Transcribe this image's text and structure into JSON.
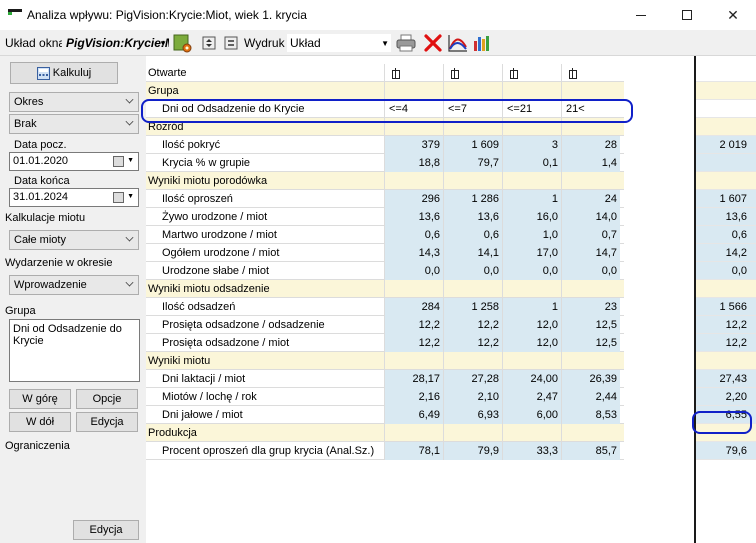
{
  "window": {
    "title": "Analiza wpływu: PigVision:Krycie:Miot, wiek 1. krycia",
    "min_glyph": "",
    "close_glyph": "✕"
  },
  "toolbar": {
    "layout_label": "Układ okna",
    "layout_value": "PigVision:Krycie:M",
    "print_label": "Wydruk",
    "print_value": "Układ",
    "icons": [
      "settings-gear-icon",
      "expand-icon",
      "collapse-icon",
      "printer-icon",
      "delete-icon",
      "chart-curve-icon",
      "bar-chart-icon"
    ]
  },
  "left": {
    "calculate_button": "Kalkuluj",
    "period_combo": "Okres",
    "none_combo": "Brak",
    "start_date_label": "Data pocz.",
    "start_date": "01.01.2020",
    "end_date_label": "Data końca",
    "end_date": "31.01.2024",
    "litter_calc_label": "Kalkulacje miotu",
    "litter_calc_value": "Całe mioty",
    "event_label": "Wydarzenie w okresie",
    "event_value": "Wprowadzenie",
    "group_label": "Grupa",
    "group_value": "Dni od Odsadzenie do Krycie",
    "up_button": "W górę",
    "options_button": "Opcje",
    "down_button": "W dół",
    "edit_button": "Edycja",
    "limits_label": "Ograniczenia",
    "limits_edit_button": "Edycja"
  },
  "grid": {
    "columns": [
      "<=4",
      "<=7",
      "<=21",
      "21<"
    ],
    "rows": [
      {
        "type": "hdr",
        "label": "Otwarte",
        "pins": true
      },
      {
        "type": "group",
        "label": "Grupa"
      },
      {
        "type": "hdr",
        "label": "Dni od Odsadzenie do Krycie",
        "indent": true,
        "values": [
          "<=4",
          "<=7",
          "<=21",
          "21<"
        ]
      },
      {
        "type": "group",
        "label": "Rozród"
      },
      {
        "type": "data",
        "label": "Ilość pokryć",
        "values": [
          "379",
          "1 609",
          "3",
          "28"
        ],
        "total": "2 019"
      },
      {
        "type": "data",
        "label": "Krycia % w grupie",
        "values": [
          "18,8",
          "79,7",
          "0,1",
          "1,4"
        ],
        "total": ""
      },
      {
        "type": "group",
        "label": "Wyniki miotu porodówka"
      },
      {
        "type": "data",
        "label": "Ilość oproszeń",
        "values": [
          "296",
          "1 286",
          "1",
          "24"
        ],
        "total": "1 607"
      },
      {
        "type": "data",
        "label": "Żywo urodzone / miot",
        "values": [
          "13,6",
          "13,6",
          "16,0",
          "14,0"
        ],
        "total": "13,6"
      },
      {
        "type": "data",
        "label": "Martwo urodzone / miot",
        "values": [
          "0,6",
          "0,6",
          "1,0",
          "0,7"
        ],
        "total": "0,6"
      },
      {
        "type": "data",
        "label": "Ogółem urodzone / miot",
        "values": [
          "14,3",
          "14,1",
          "17,0",
          "14,7"
        ],
        "total": "14,2"
      },
      {
        "type": "data",
        "label": "Urodzone słabe / miot",
        "values": [
          "0,0",
          "0,0",
          "0,0",
          "0,0"
        ],
        "total": "0,0"
      },
      {
        "type": "group",
        "label": "Wyniki miotu odsadzenie"
      },
      {
        "type": "data",
        "label": "Ilość odsadzeń",
        "values": [
          "284",
          "1 258",
          "1",
          "23"
        ],
        "total": "1 566"
      },
      {
        "type": "data",
        "label": "Prosięta odsadzone / odsadzenie",
        "values": [
          "12,2",
          "12,2",
          "12,0",
          "12,5"
        ],
        "total": "12,2"
      },
      {
        "type": "data",
        "label": "Prosięta odsadzone / miot",
        "values": [
          "12,2",
          "12,2",
          "12,0",
          "12,5"
        ],
        "total": "12,2"
      },
      {
        "type": "group",
        "label": "Wyniki miotu"
      },
      {
        "type": "data",
        "label": "Dni laktacji / miot",
        "values": [
          "28,17",
          "27,28",
          "24,00",
          "26,39"
        ],
        "total": "27,43"
      },
      {
        "type": "data",
        "label": "Miotów / lochę / rok",
        "values": [
          "2,16",
          "2,10",
          "2,47",
          "2,44"
        ],
        "total": "2,20"
      },
      {
        "type": "data",
        "label": "Dni jałowe / miot",
        "values": [
          "6,49",
          "6,93",
          "6,00",
          "8,53"
        ],
        "total": "6,55"
      },
      {
        "type": "group",
        "label": "Produkcja"
      },
      {
        "type": "data",
        "label": "Procent oproszeń dla grup krycia (Anal.Sz.)",
        "values": [
          "78,1",
          "79,9",
          "33,3",
          "85,7"
        ],
        "total": "79,6"
      }
    ]
  },
  "colors": {
    "group_bg": "#fbf6d9",
    "data_bg": "#d9e9f2",
    "highlight": "#1020c8"
  }
}
